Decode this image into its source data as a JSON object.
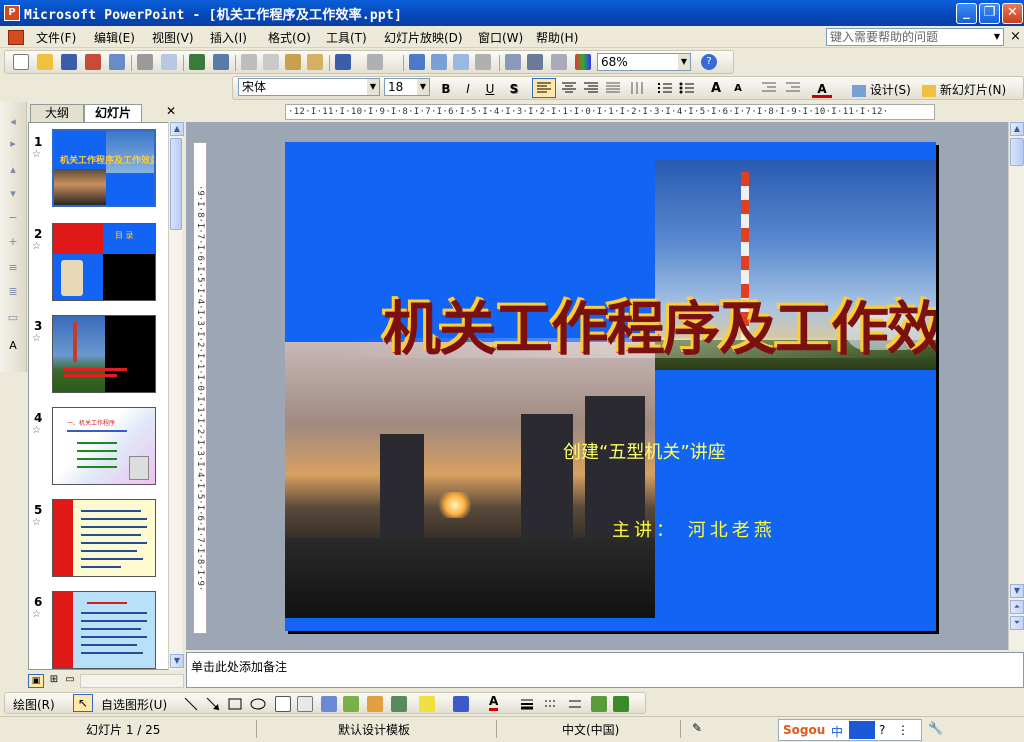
{
  "window": {
    "app_icon": "powerpoint-icon",
    "title": "Microsoft PowerPoint - [机关工作程序及工作效率.ppt]",
    "buttons": {
      "minimize": "_",
      "restore": "❐",
      "close": "✕"
    }
  },
  "menu": {
    "items": [
      "文件(F)",
      "编辑(E)",
      "视图(V)",
      "插入(I)",
      "格式(O)",
      "工具(T)",
      "幻灯片放映(D)",
      "窗口(W)",
      "帮助(H)"
    ],
    "help_placeholder": "键入需要帮助的问题",
    "close_glyph": "×"
  },
  "standard_toolbar": {
    "zoom": "68%"
  },
  "formatting_toolbar": {
    "font": "宋体",
    "size": "18",
    "bold": "B",
    "italic": "I",
    "underline": "U",
    "shadow": "S",
    "grow": "A",
    "shrink": "A",
    "font_color": "A",
    "design_label": "设计(S)",
    "new_slide_label": "新幻灯片(N)"
  },
  "outline_pane": {
    "tabs": [
      "大纲",
      "幻灯片"
    ],
    "close_glyph": "✕",
    "slides": [
      {
        "number": "1",
        "title": "机关工作程序及工作效益"
      },
      {
        "number": "2",
        "title": "目 录"
      },
      {
        "number": "3",
        "title": ""
      },
      {
        "number": "4",
        "title": "一、机关工作程序"
      },
      {
        "number": "5",
        "title": ""
      },
      {
        "number": "6",
        "title": ""
      }
    ]
  },
  "ruler": {
    "horizontal": "·12·I·11·I·10·I·9·I·8·I·7·I·6·I·5·I·4·I·3·I·2·I·1·I·0·I·1·I·2·I·3·I·4·I·5·I·6·I·7·I·8·I·9·I·10·I·11·I·12·",
    "vertical": "·9·I·8·I·7·I·6·I·5·I·4·I·3·I·2·I·1·I·0·I·1·I·2·I·3·I·4·I·5·I·6·I·7·I·8·I·9·"
  },
  "slide": {
    "title": "机关工作程序及工作效益",
    "subtitle": "创建“五型机关”讲座",
    "presenter": "主讲： 河北老燕"
  },
  "notes": {
    "placeholder": "单击此处添加备注"
  },
  "drawing_toolbar": {
    "draw_label": "绘图(R)",
    "autoshapes_label": "自选图形(U)"
  },
  "status": {
    "slide_position": "幻灯片 1 / 25",
    "template": "默认设计模板",
    "language": "中文(中国)",
    "ime": "Sogou"
  },
  "colors": {
    "slide_background": "#1264f4",
    "title_text": "#ff4a1a",
    "subtitle_text": "#ffff66",
    "titlebar": "#0a5fd8"
  }
}
